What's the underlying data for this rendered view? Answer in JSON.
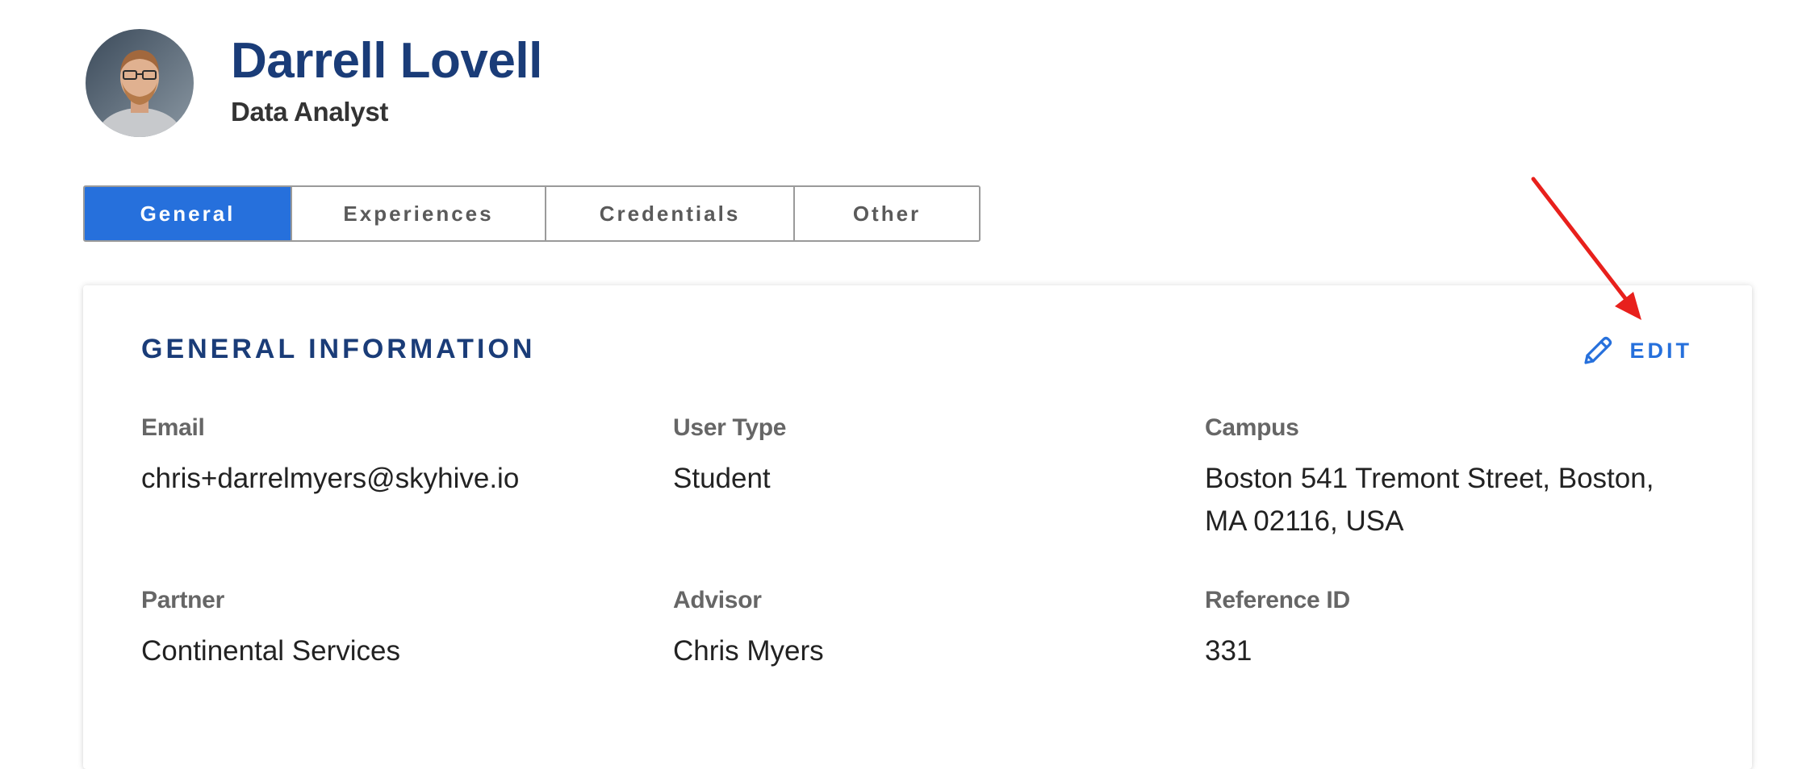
{
  "profile": {
    "name": "Darrell Lovell",
    "role": "Data Analyst"
  },
  "tabs": [
    {
      "label": "General",
      "active": true
    },
    {
      "label": "Experiences",
      "active": false
    },
    {
      "label": "Credentials",
      "active": false
    },
    {
      "label": "Other",
      "active": false
    }
  ],
  "card": {
    "title": "GENERAL INFORMATION",
    "edit_label": "EDIT",
    "fields": {
      "email": {
        "label": "Email",
        "value": "chris+darrelmyers@skyhive.io"
      },
      "user_type": {
        "label": "User Type",
        "value": "Student"
      },
      "campus": {
        "label": "Campus",
        "value": "Boston 541 Tremont Street, Boston, MA 02116, USA"
      },
      "partner": {
        "label": "Partner",
        "value": "Continental Services"
      },
      "advisor": {
        "label": "Advisor",
        "value": "Chris Myers"
      },
      "reference_id": {
        "label": "Reference ID",
        "value": "331"
      }
    }
  },
  "colors": {
    "brand_navy": "#1a3c78",
    "accent_blue": "#2670dc",
    "annotation_red": "#e8201c"
  },
  "icons": {
    "edit": "pencil-icon",
    "annotation": "red-arrow-annotation"
  }
}
